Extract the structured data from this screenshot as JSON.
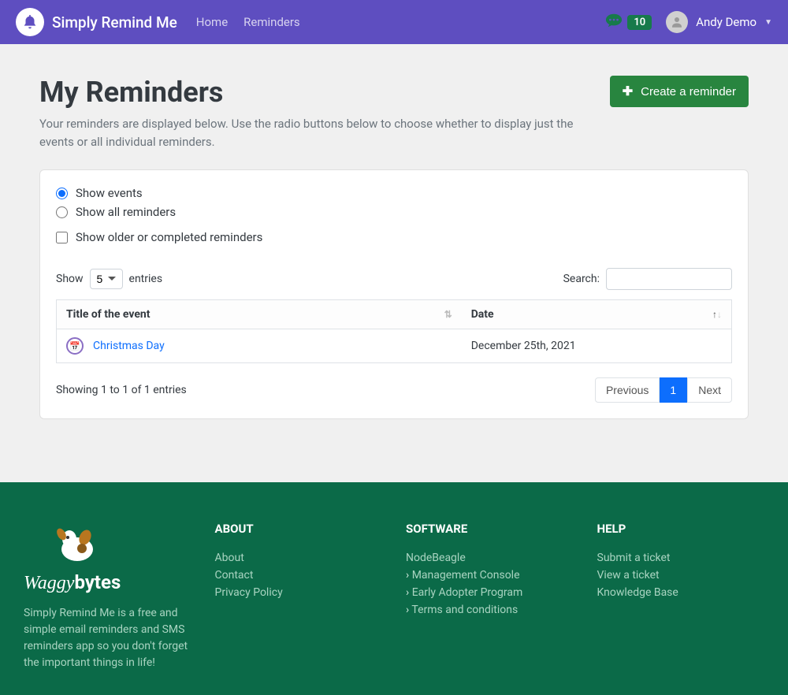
{
  "brand": "Simply Remind Me",
  "nav": {
    "home": "Home",
    "reminders": "Reminders"
  },
  "notifications": {
    "count": "10"
  },
  "user": {
    "name": "Andy Demo"
  },
  "page": {
    "title": "My Reminders",
    "description": "Your reminders are displayed below. Use the radio buttons below to choose whether to display just the events or all individual reminders.",
    "create_button": "Create a reminder"
  },
  "filters": {
    "show_events": "Show events",
    "show_all": "Show all reminders",
    "show_older": "Show older or completed reminders"
  },
  "table": {
    "show_label": "Show",
    "entries_label": "entries",
    "page_size": "5",
    "page_size_options": [
      "5"
    ],
    "search_label": "Search:",
    "col_title": "Title of the event",
    "col_date": "Date",
    "rows": [
      {
        "title": "Christmas Day",
        "date": "December 25th, 2021"
      }
    ],
    "info": "Showing 1 to 1 of 1 entries",
    "prev": "Previous",
    "next": "Next",
    "current_page": "1"
  },
  "footer": {
    "brand_a": "Waggy",
    "brand_b": "bytes",
    "desc": "Simply Remind Me is a free and simple email reminders and SMS reminders app so you don't forget the important things in life!",
    "about_h": "ABOUT",
    "about": [
      "About",
      "Contact",
      "Privacy Policy"
    ],
    "software_h": "SOFTWARE",
    "software_top": "NodeBeagle",
    "software_sub": [
      "Management Console",
      "Early Adopter Program",
      "Terms and conditions"
    ],
    "help_h": "HELP",
    "help": [
      "Submit a ticket",
      "View a ticket",
      "Knowledge Base"
    ]
  }
}
